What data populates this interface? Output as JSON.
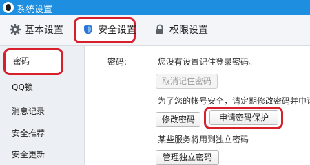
{
  "window": {
    "title": "系统设置"
  },
  "tabs": [
    {
      "label": "基本设置",
      "icon": "gear-icon"
    },
    {
      "label": "安全设置",
      "icon": "shield-icon",
      "active": true
    },
    {
      "label": "权限设置",
      "icon": "lock-icon"
    }
  ],
  "sidebar": {
    "items": [
      {
        "label": "密码",
        "active": true
      },
      {
        "label": "QQ锁"
      },
      {
        "label": "消息记录"
      },
      {
        "label": "安全推荐"
      },
      {
        "label": "安全更新"
      }
    ]
  },
  "password_panel": {
    "field_label": "密码:",
    "no_remember_msg": "您没有设置记住登录密码。",
    "clear_button": "取消记住密码",
    "security_tip": "为了您的帐号安全，请定期修改密码并申请",
    "modify_button": "修改密码",
    "apply_protect_button": "申请密码保护",
    "independent_tip": "某些服务将用到独立密码",
    "independent_button": "管理独立密码"
  },
  "colors": {
    "titlebar": "#1e8fe0",
    "highlight_outline": "#d8202c",
    "sidebar_bg": "#eceff3"
  }
}
